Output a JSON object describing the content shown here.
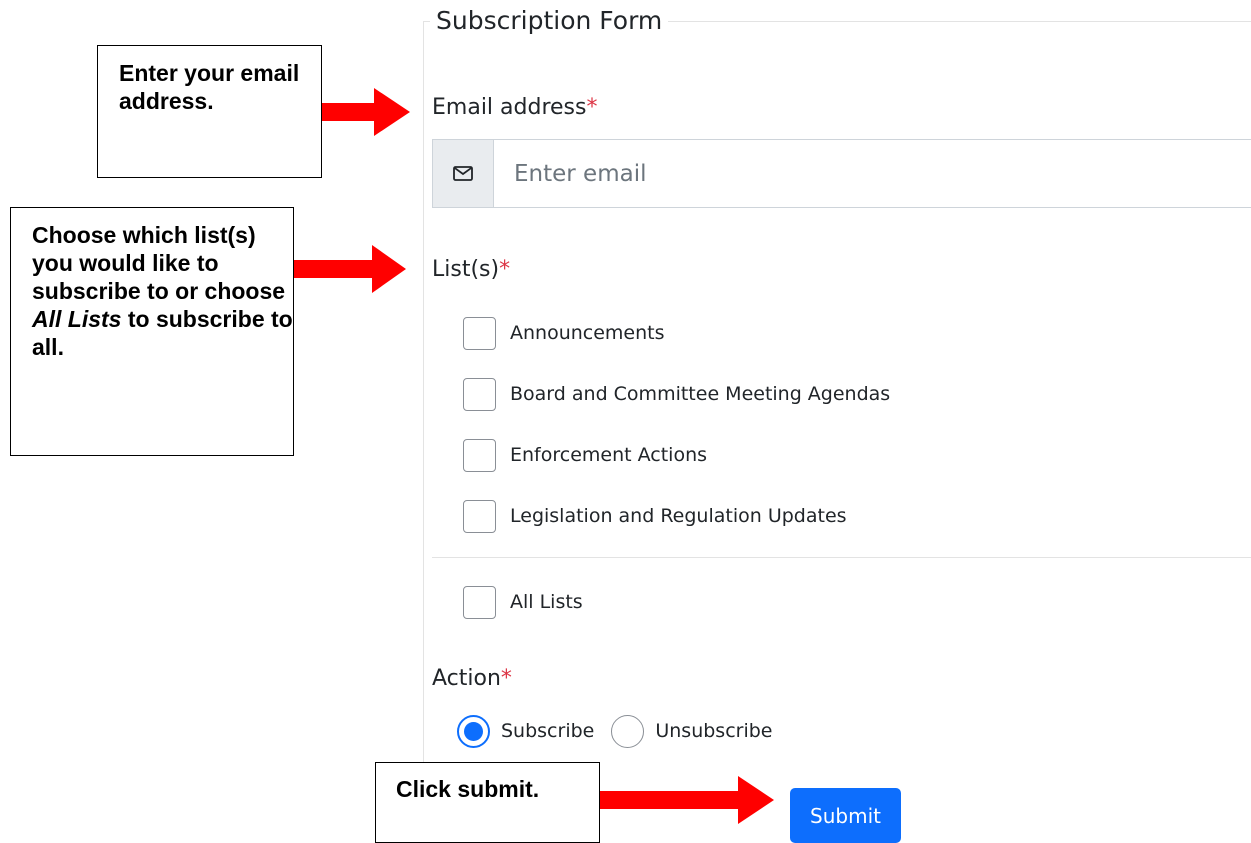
{
  "form": {
    "legend": "Subscription Form",
    "required_mark": "*",
    "email": {
      "label": "Email address",
      "placeholder": "Enter email",
      "value": "",
      "icon": "envelope-icon"
    },
    "lists": {
      "label": "List(s)",
      "items": [
        {
          "label": "Announcements",
          "checked": false
        },
        {
          "label": "Board and Committee Meeting Agendas",
          "checked": false
        },
        {
          "label": "Enforcement Actions",
          "checked": false
        },
        {
          "label": "Legislation and Regulation Updates",
          "checked": false
        }
      ],
      "all_lists": {
        "label": "All Lists",
        "checked": false
      }
    },
    "action": {
      "label": "Action",
      "options": [
        {
          "label": "Subscribe",
          "selected": true
        },
        {
          "label": "Unsubscribe",
          "selected": false
        }
      ]
    },
    "submit_label": "Submit"
  },
  "annotations": {
    "email_note": "Enter your email address.",
    "lists_note": {
      "prefix": "Choose which list(s) you would like to subscribe to or choose ",
      "emphasis": "All Lists",
      "suffix": " to subscribe to all."
    },
    "submit_note": "Click submit."
  },
  "colors": {
    "primary": "#0d6efd",
    "required": "#dc3545",
    "arrow": "#ff0000",
    "border": "#ced4da",
    "addon_bg": "#e9ecef"
  }
}
